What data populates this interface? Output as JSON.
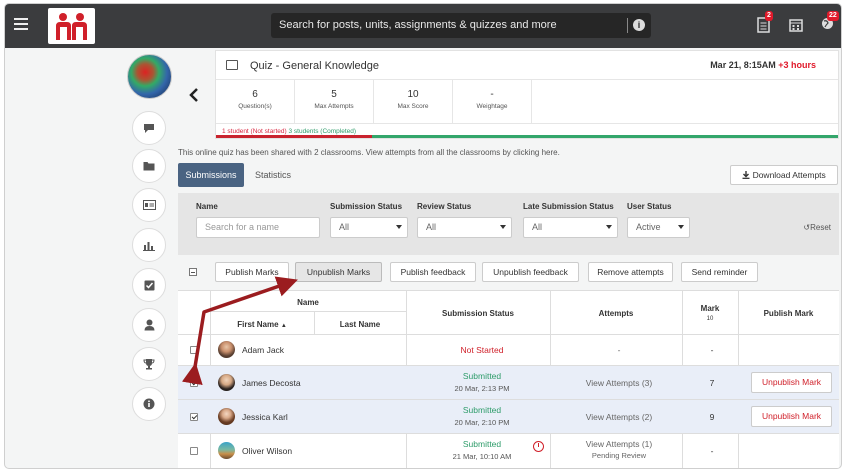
{
  "topbar": {
    "search_placeholder": "Search for posts, units, assignments & quizzes and more",
    "badge_notes": "2",
    "badge_notifications": "22"
  },
  "quiz": {
    "title": "Quiz - General Knowledge",
    "date": "Mar 21, 8:15AM",
    "late": "+3 hours",
    "stats": [
      {
        "value": "6",
        "label": "Question(s)"
      },
      {
        "value": "5",
        "label": "Max Attempts"
      },
      {
        "value": "10",
        "label": "Max Score"
      },
      {
        "value": "-",
        "label": "Weightage"
      }
    ],
    "not_started": "1 student (Not started)",
    "completed": "3 students (Completed)",
    "completed_fraction": 0.75
  },
  "shared": {
    "text": "This online quiz has been shared with 2 classrooms. View attempts from all the classrooms by",
    "link": "clicking here."
  },
  "tabs": {
    "submissions": "Submissions",
    "statistics": "Statistics"
  },
  "download_label": "Download Attempts",
  "filters": {
    "name_label": "Name",
    "name_placeholder": "Search for a name",
    "submission_label": "Submission Status",
    "submission_value": "All",
    "review_label": "Review Status",
    "review_value": "All",
    "late_label": "Late Submission Status",
    "late_value": "All",
    "user_label": "User Status",
    "user_value": "Active",
    "reset": "Reset"
  },
  "actions": [
    "Publish Marks",
    "Unpublish Marks",
    "Publish feedback",
    "Unpublish feedback",
    "Remove attempts",
    "Send reminder"
  ],
  "table": {
    "name_header": "Name",
    "first_name": "First Name",
    "last_name": "Last Name",
    "submission_status": "Submission Status",
    "attempts": "Attempts",
    "mark": "Mark",
    "mark_max": "10",
    "publish_mark": "Publish Mark",
    "rows": [
      {
        "name": "Adam Jack",
        "status": "Not Started",
        "date": "",
        "attempts": "-",
        "pending": "",
        "mark": "-",
        "publish": "",
        "checked": false
      },
      {
        "name": "James Decosta",
        "status": "Submitted",
        "date": "20 Mar, 2:13 PM",
        "attempts": "View Attempts (3)",
        "pending": "",
        "mark": "7",
        "publish": "Unpublish Mark",
        "checked": true
      },
      {
        "name": "Jessica Karl",
        "status": "Submitted",
        "date": "20 Mar, 2:10 PM",
        "attempts": "View Attempts (2)",
        "pending": "",
        "mark": "9",
        "publish": "Unpublish Mark",
        "checked": true
      },
      {
        "name": "Oliver Wilson",
        "status": "Submitted",
        "date": "21 Mar, 10:10 AM",
        "attempts": "View Attempts (1)",
        "pending": "Pending Review",
        "mark": "-",
        "publish": "",
        "checked": false
      }
    ]
  },
  "colors": {
    "accent": "#4a6382",
    "danger": "#d0202a",
    "success": "#2e9c6a",
    "topbar": "#3b3c3e",
    "annotation_arrow": "#9b1c1f"
  }
}
